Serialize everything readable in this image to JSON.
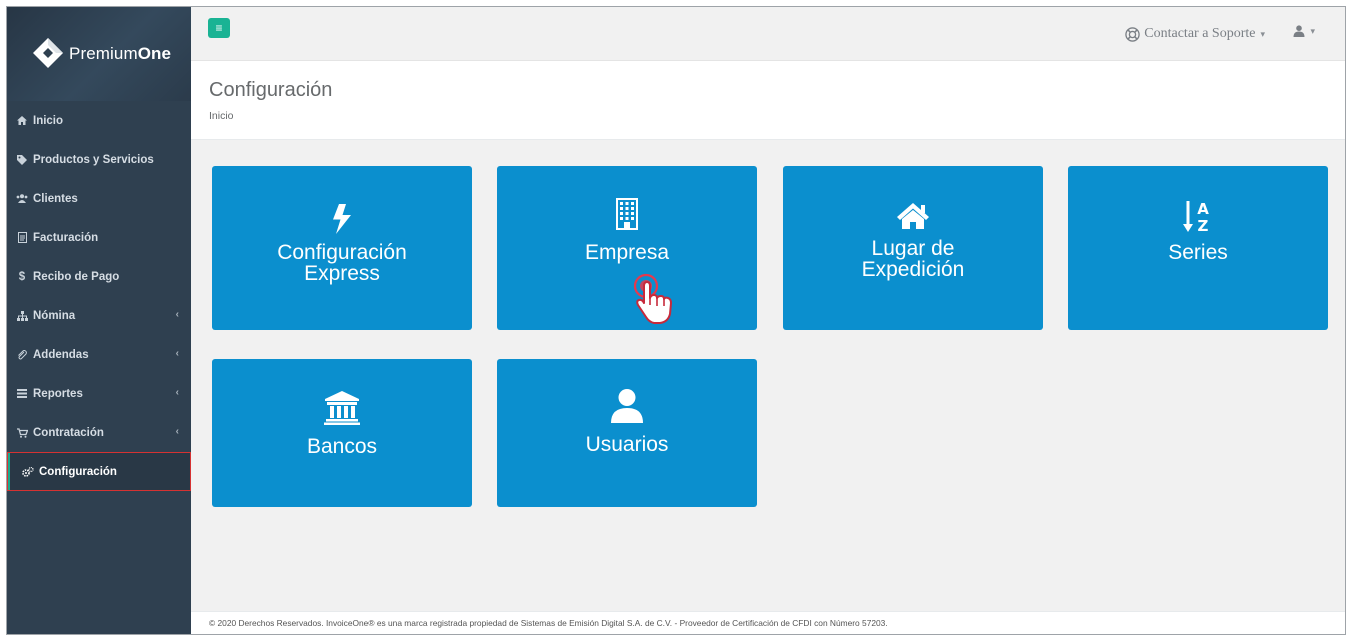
{
  "brand": {
    "name_light": "Premium",
    "name_bold": "One"
  },
  "sidebar": {
    "items": [
      {
        "label": "Inicio",
        "icon": "home-icon"
      },
      {
        "label": "Productos y Servicios",
        "icon": "tag-icon"
      },
      {
        "label": "Clientes",
        "icon": "users-icon"
      },
      {
        "label": "Facturación",
        "icon": "invoice-icon"
      },
      {
        "label": "Recibo de Pago",
        "icon": "dollar-icon"
      },
      {
        "label": "Nómina",
        "icon": "sitemap-icon",
        "chevron": "‹"
      },
      {
        "label": "Addendas",
        "icon": "paperclip-icon",
        "chevron": "‹"
      },
      {
        "label": "Reportes",
        "icon": "list-icon",
        "chevron": "‹"
      },
      {
        "label": "Contratación",
        "icon": "cart-icon",
        "chevron": "‹"
      },
      {
        "label": "Configuración",
        "icon": "cogs-icon",
        "active": true
      }
    ]
  },
  "topbar": {
    "menu_icon": "≡",
    "support_label": "Contactar a Soporte",
    "caret": "▾"
  },
  "page": {
    "title": "Configuración",
    "breadcrumb": "Inicio"
  },
  "tiles": [
    {
      "line1": "Configuración",
      "line2": "Express",
      "icon": "bolt-icon"
    },
    {
      "line1": "Empresa",
      "line2": "",
      "icon": "building-icon"
    },
    {
      "line1": "Lugar de",
      "line2": "Expedición",
      "icon": "home-icon"
    },
    {
      "line1": "Series",
      "line2": "",
      "icon": "sort-alpha-icon"
    },
    {
      "line1": "Bancos",
      "line2": "",
      "icon": "bank-icon"
    },
    {
      "line1": "Usuarios",
      "line2": "",
      "icon": "user-icon"
    }
  ],
  "colors": {
    "tile": "#0b8fce",
    "sidebar": "#2f4050",
    "accent": "#1ab394",
    "highlight": "#d63232"
  },
  "footer": {
    "text": "© 2020 Derechos Reservados. InvoiceOne® es una marca registrada propiedad de Sistemas de Emisión Digital S.A. de C.V. - Proveedor de Certificación de CFDI con Número 57203."
  }
}
